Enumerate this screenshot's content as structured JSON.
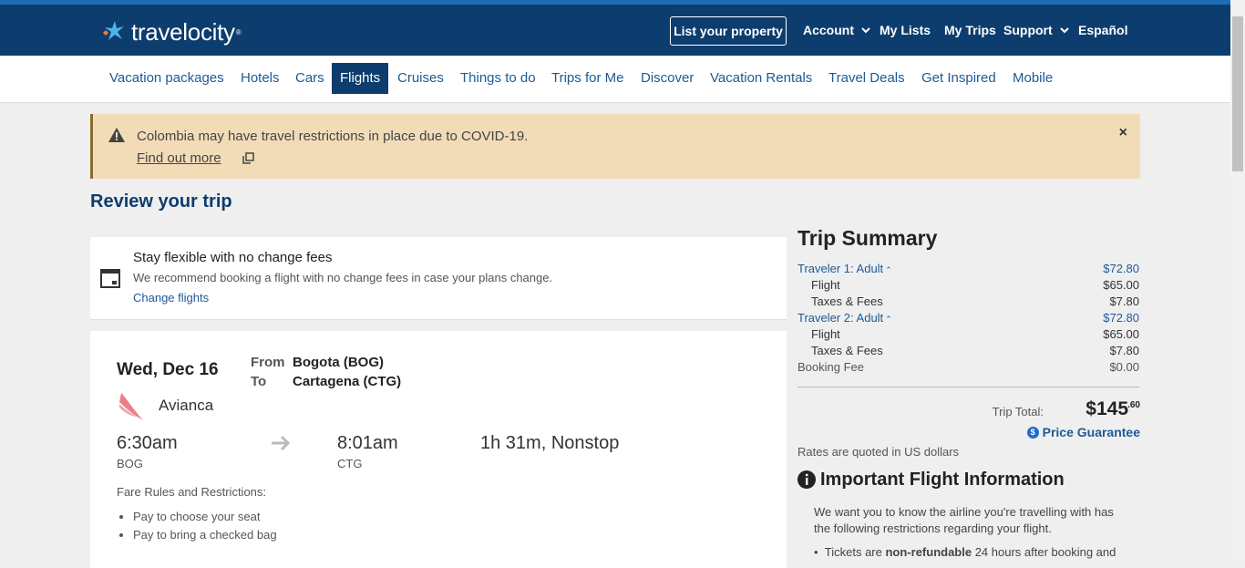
{
  "header": {
    "logo_text": "travelocity",
    "logo_mark": "®",
    "list_property": "List your property",
    "nav": [
      {
        "label": "Account",
        "has_dropdown": true
      },
      {
        "label": "My Lists",
        "has_dropdown": false
      },
      {
        "label": "My Trips",
        "has_dropdown": false
      },
      {
        "label": "Support",
        "has_dropdown": true
      },
      {
        "label": "Español",
        "has_dropdown": false
      }
    ]
  },
  "navbar": {
    "items": [
      "Vacation packages",
      "Hotels",
      "Cars",
      "Flights",
      "Cruises",
      "Things to do",
      "Trips for Me",
      "Discover",
      "Vacation Rentals",
      "Travel Deals",
      "Get Inspired",
      "Mobile"
    ],
    "active": "Flights"
  },
  "alert": {
    "message": "Colombia may have travel restrictions in place due to COVID-19.",
    "link": "Find out more",
    "close": "×"
  },
  "review_title": "Review your trip",
  "flex_card": {
    "title": "Stay flexible with no change fees",
    "body": "We recommend booking a flight with no change fees in case your plans change.",
    "link": "Change flights"
  },
  "flight": {
    "date": "Wed, Dec 16",
    "from_label": "From",
    "to_label": "To",
    "from": "Bogota (BOG)",
    "to": "Cartagena (CTG)",
    "airline": "Avianca",
    "depart_time": "6:30am",
    "depart_code": "BOG",
    "arrive_time": "8:01am",
    "arrive_code": "CTG",
    "duration": "1h 31m, Nonstop",
    "rules_title": "Fare Rules and Restrictions:",
    "rules": [
      "Pay to choose your seat",
      "Pay to bring a checked bag"
    ]
  },
  "summary": {
    "title": "Trip Summary",
    "traveler1": {
      "label": "Traveler 1: Adult",
      "total": "$72.80",
      "flight_label": "Flight",
      "flight": "$65.00",
      "taxes_label": "Taxes & Fees",
      "taxes": "$7.80"
    },
    "traveler2": {
      "label": "Traveler 2: Adult",
      "total": "$72.80",
      "flight_label": "Flight",
      "flight": "$65.00",
      "taxes_label": "Taxes & Fees",
      "taxes": "$7.80"
    },
    "booking_fee_label": "Booking Fee",
    "booking_fee": "$0.00",
    "trip_total_label": "Trip Total:",
    "trip_total": "$145",
    "trip_total_cents": ".60",
    "price_guarantee": "Price Guarantee",
    "rates_note": "Rates are quoted in US dollars"
  },
  "important": {
    "title": "Important Flight Information",
    "text": "We want you to know the airline you're travelling with has the following restrictions regarding your flight.",
    "bullet_prefix": "Tickets are ",
    "bullet_bold": "non-refundable",
    "bullet_suffix": " 24 hours after booking and"
  },
  "colors": {
    "header_bg": "#0d3d6e",
    "link": "#1e5a96",
    "alert_bg": "#f2dcb8",
    "page_bg": "#efefef"
  }
}
